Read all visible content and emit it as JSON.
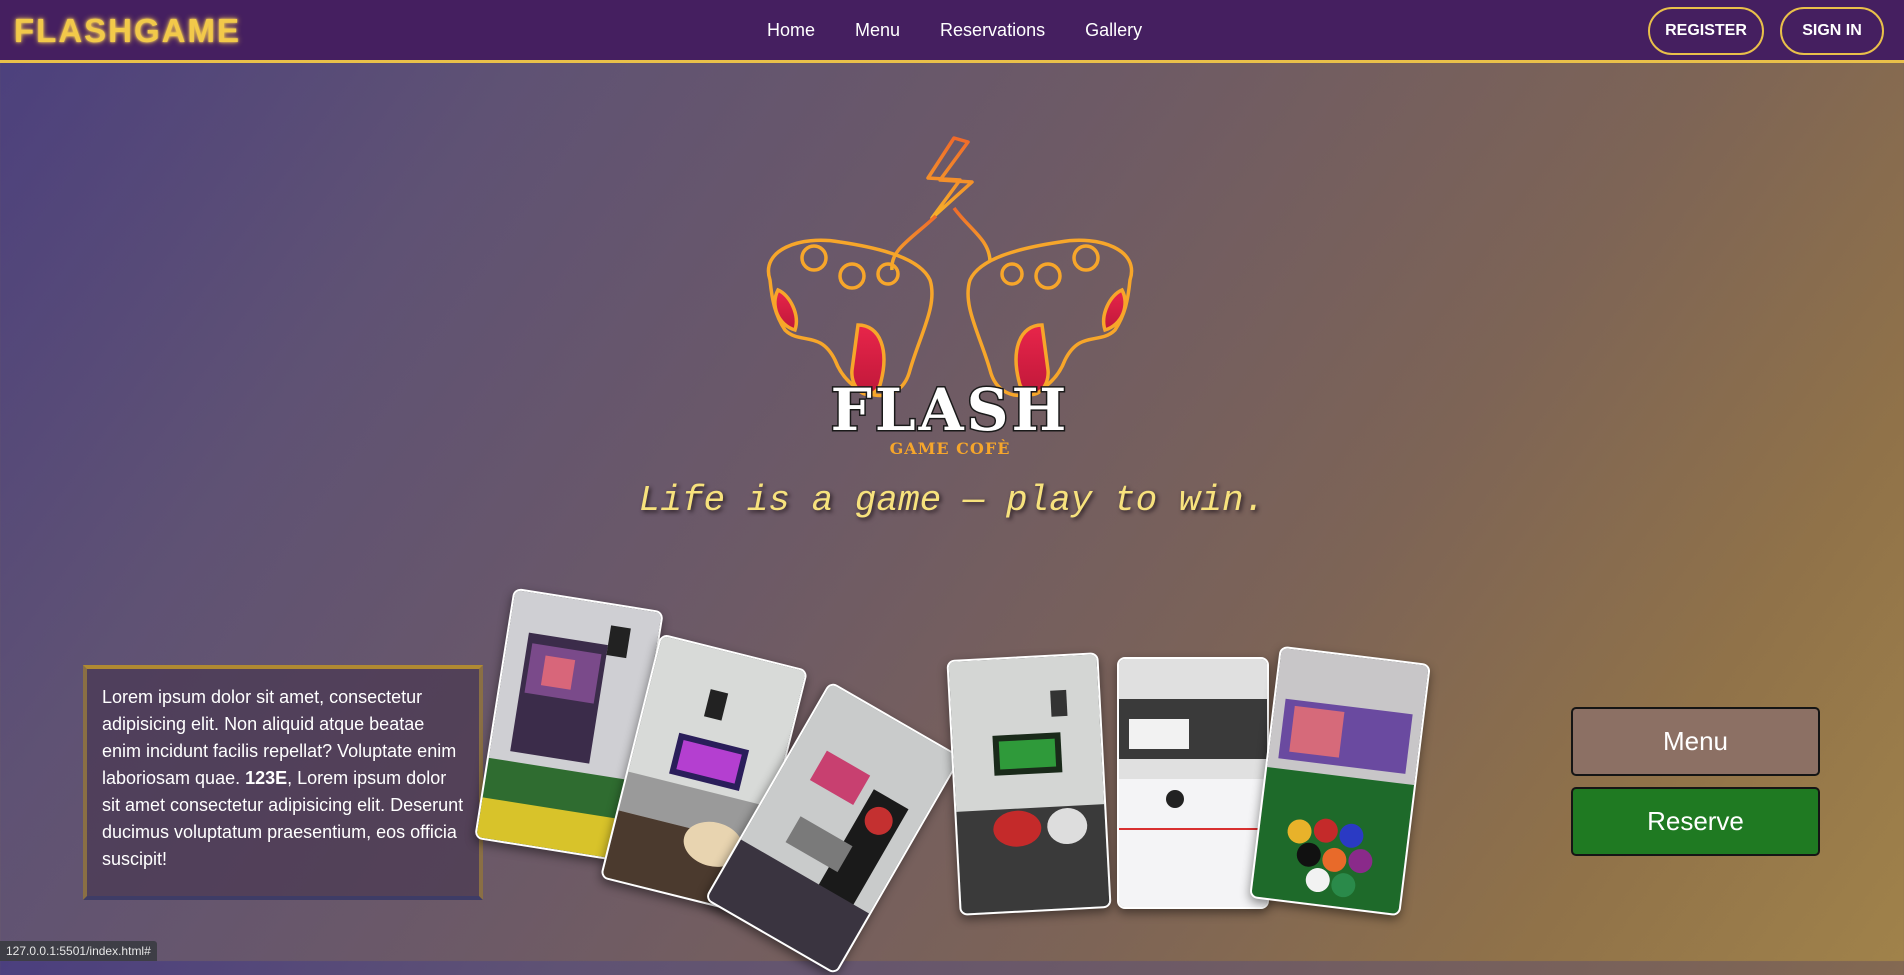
{
  "header": {
    "brand": "FLASHGAME",
    "nav": [
      "Home",
      "Menu",
      "Reservations",
      "Gallery"
    ],
    "register_label": "REGISTER",
    "signin_label": "SIGN IN"
  },
  "hero": {
    "logo_title": "FLASH",
    "logo_subtitle": "GAME COFÈ",
    "tagline": "Life is a game — play to win."
  },
  "info": {
    "text_before": "Lorem ipsum dolor sit amet, consectetur adipisicing elit. Non aliquid atque beatae enim incidunt facilis repellat? Voluptate enim laboriosam quae. ",
    "bold": "123E",
    "text_after": ", Lorem ipsum dolor sit amet consectetur adipisicing elit. Deserunt ducimus voluptatum praesentium, eos officia suscipit!"
  },
  "gallery": {
    "photos": [
      "foosball-table",
      "tv-lounge",
      "darts-room",
      "gaming-room",
      "air-hockey-table",
      "billiard-balls"
    ]
  },
  "actions": {
    "menu_label": "Menu",
    "reserve_label": "Reserve"
  },
  "status_bar": "127.0.0.1:5501/index.html#",
  "colors": {
    "nav_bg": "#451f60",
    "accent_gold": "#e9c04a",
    "menu_button": "#8c7064",
    "reserve_button": "#1f7a22"
  }
}
